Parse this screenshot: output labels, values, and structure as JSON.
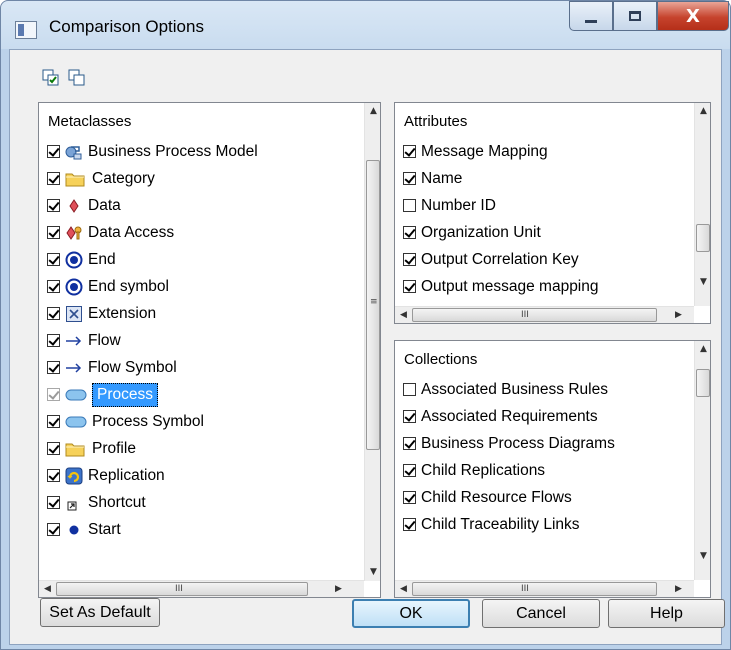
{
  "window": {
    "title": "Comparison Options",
    "close_glyph": "X"
  },
  "toolbar": {
    "icons": [
      "check-all-icon",
      "uncheck-all-icon"
    ]
  },
  "metaclasses": {
    "header": "Metaclasses",
    "items": [
      {
        "label": "Business Process Model",
        "checked": true,
        "icon": "business-process-model-icon"
      },
      {
        "label": "Category",
        "checked": true,
        "icon": "folder-icon"
      },
      {
        "label": "Data",
        "checked": true,
        "icon": "data-icon"
      },
      {
        "label": "Data Access",
        "checked": true,
        "icon": "data-access-icon"
      },
      {
        "label": "End",
        "checked": true,
        "icon": "end-icon"
      },
      {
        "label": "End symbol",
        "checked": true,
        "icon": "end-icon"
      },
      {
        "label": "Extension",
        "checked": true,
        "icon": "extension-icon"
      },
      {
        "label": "Flow",
        "checked": true,
        "icon": "arrow-right-icon"
      },
      {
        "label": "Flow Symbol",
        "checked": true,
        "icon": "arrow-right-icon"
      },
      {
        "label": "Process",
        "checked": true,
        "icon": "process-icon",
        "selected": true
      },
      {
        "label": "Process Symbol",
        "checked": true,
        "icon": "process-icon"
      },
      {
        "label": "Profile",
        "checked": true,
        "icon": "folder-icon"
      },
      {
        "label": "Replication",
        "checked": true,
        "icon": "replication-icon"
      },
      {
        "label": "Shortcut",
        "checked": true,
        "icon": "shortcut-icon"
      },
      {
        "label": "Start",
        "checked": true,
        "icon": "start-icon"
      }
    ]
  },
  "attributes": {
    "header": "Attributes",
    "items": [
      {
        "label": "Message Mapping",
        "checked": true
      },
      {
        "label": "Name",
        "checked": true
      },
      {
        "label": "Number ID",
        "checked": false
      },
      {
        "label": "Organization Unit",
        "checked": true
      },
      {
        "label": "Output Correlation Key",
        "checked": true
      },
      {
        "label": "Output message mapping",
        "checked": true
      }
    ]
  },
  "collections": {
    "header": "Collections",
    "items": [
      {
        "label": "Associated Business Rules",
        "checked": false
      },
      {
        "label": "Associated Requirements",
        "checked": true
      },
      {
        "label": "Business Process Diagrams",
        "checked": true
      },
      {
        "label": "Child Replications",
        "checked": true
      },
      {
        "label": "Child Resource Flows",
        "checked": true
      },
      {
        "label": "Child Traceability Links",
        "checked": true
      }
    ]
  },
  "scroll_grip": "III",
  "vscroll_grip": "≡",
  "buttons": {
    "set_default": "Set As Default",
    "ok": "OK",
    "cancel": "Cancel",
    "help": "Help"
  }
}
